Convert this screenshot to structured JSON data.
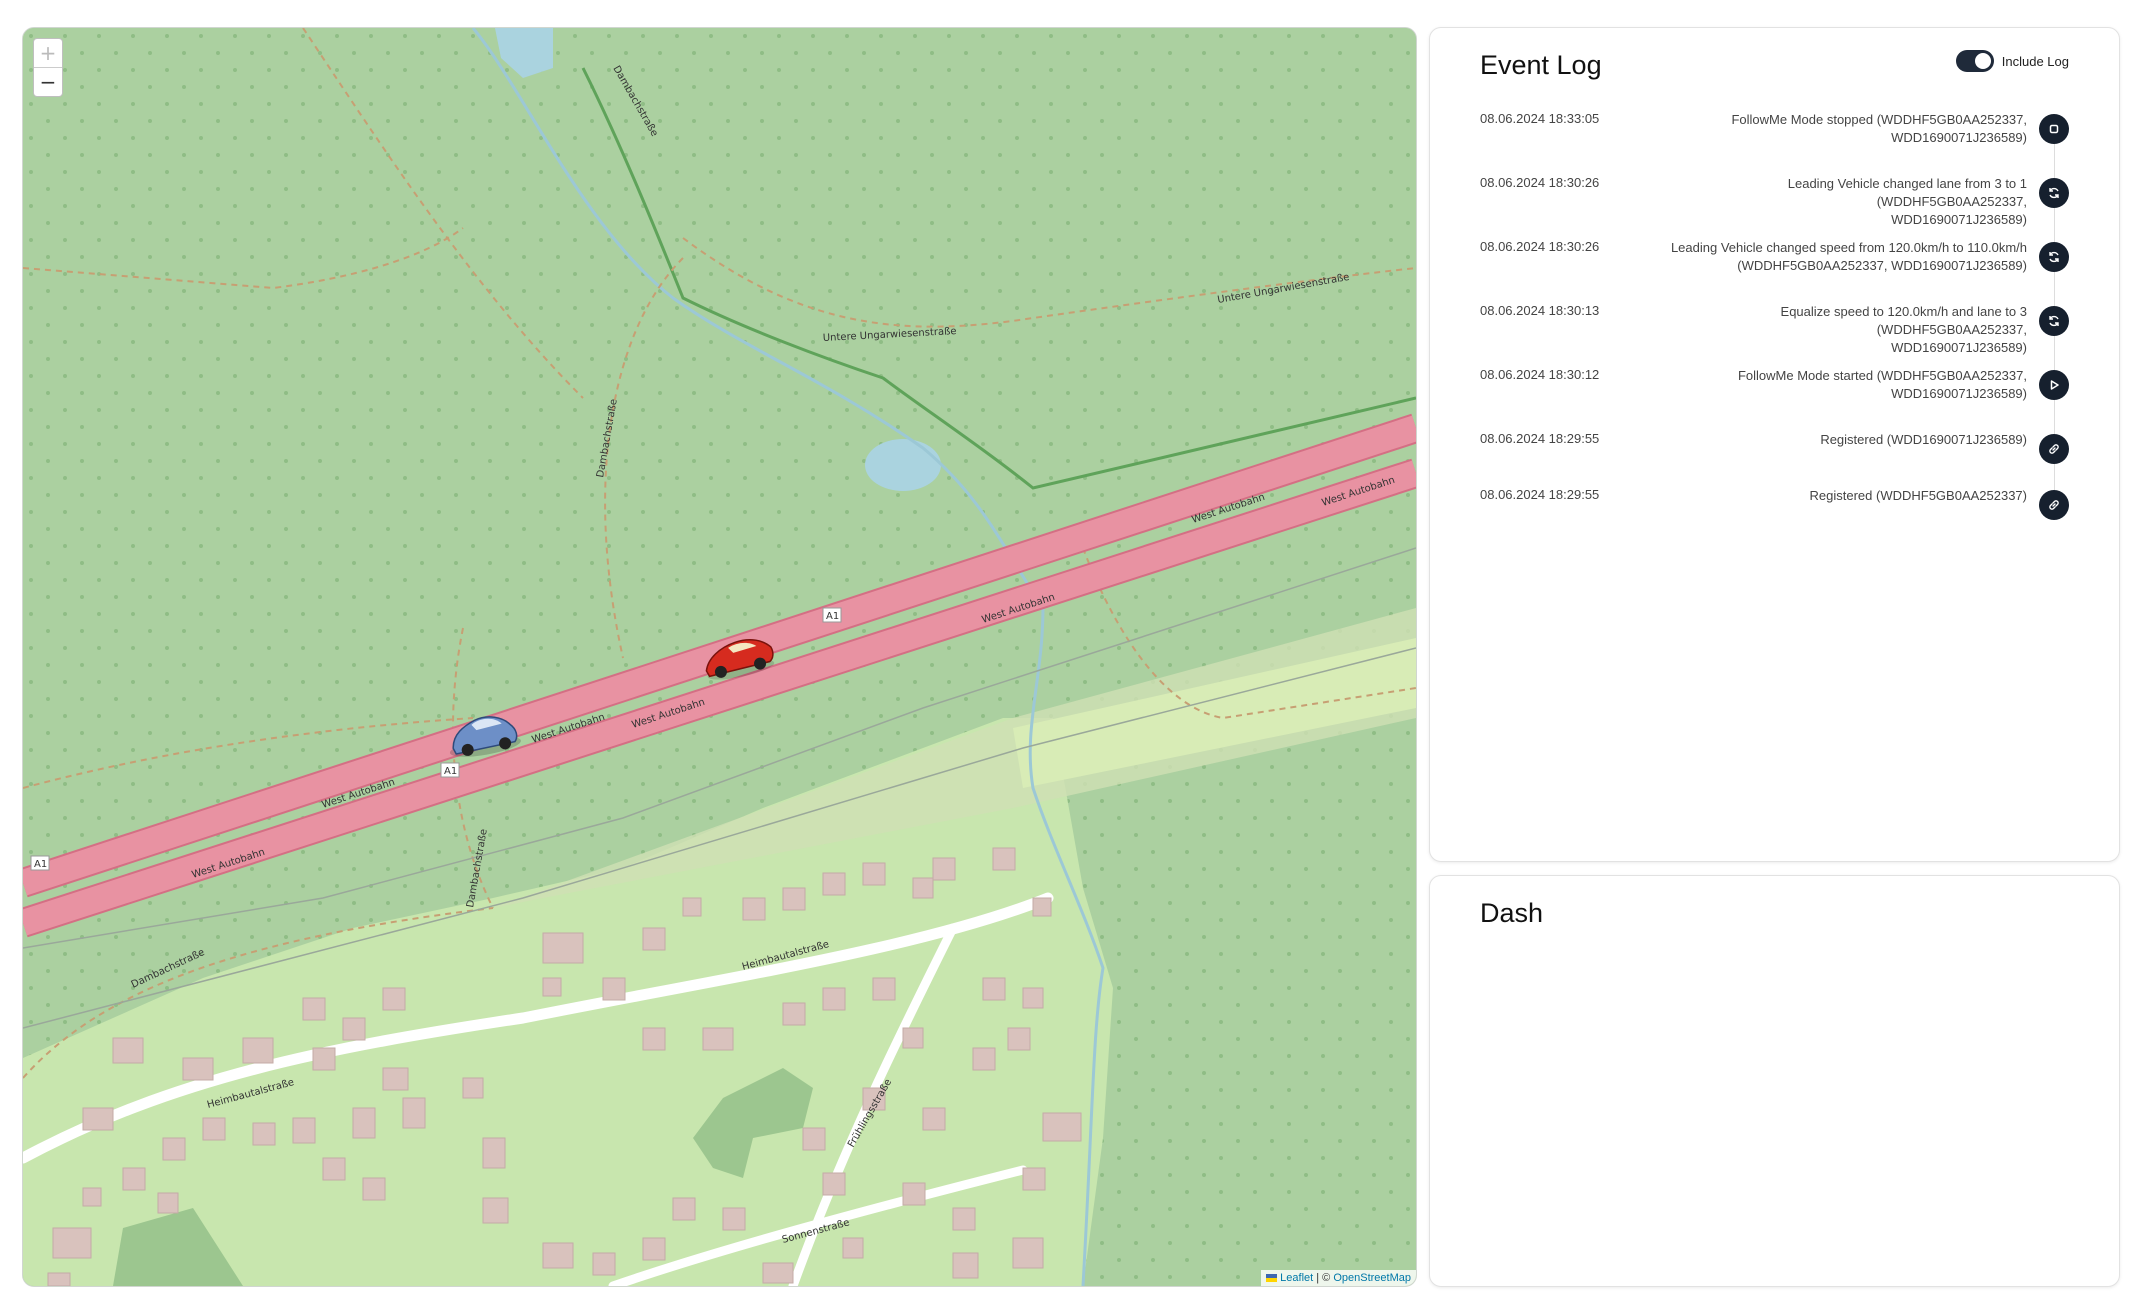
{
  "map": {
    "zoom_in": "+",
    "zoom_out": "−",
    "attribution_leaflet": "Leaflet",
    "attribution_sep": "| ©",
    "attribution_osm": "OpenStreetMap",
    "labels": {
      "west_autobahn": "West Autobahn",
      "a1": "A1",
      "heimbautal": "Heimbautalstraße",
      "untere_ungar": "Untere Ungarwiesenstraße",
      "dambach": "Dambachstraße",
      "sonnen": "Sonnenstraße",
      "fruehling": "Frühlingsstraße"
    }
  },
  "event_log": {
    "title": "Event Log",
    "include_log_label": "Include Log",
    "include_log_on": true,
    "events": [
      {
        "ts": "08.06.2024 18:33:05",
        "l1": "FollowMe Mode stopped (WDDHF5GB0AA252337,",
        "l2": "WDD1690071J236589)",
        "icon": "stop-icon"
      },
      {
        "ts": "08.06.2024 18:30:26",
        "l1": "Leading Vehicle changed lane from 3 to 1 (WDDHF5GB0AA252337,",
        "l2": "WDD1690071J236589)",
        "icon": "refresh-icon"
      },
      {
        "ts": "08.06.2024 18:30:26",
        "l1": "Leading Vehicle changed speed from 120.0km/h to 110.0km/h",
        "l2": "(WDDHF5GB0AA252337, WDD1690071J236589)",
        "icon": "refresh-icon"
      },
      {
        "ts": "08.06.2024 18:30:13",
        "l1": "Equalize speed to 120.0km/h and lane to 3 (WDDHF5GB0AA252337,",
        "l2": "WDD1690071J236589)",
        "icon": "refresh-icon"
      },
      {
        "ts": "08.06.2024 18:30:12",
        "l1": "FollowMe Mode started (WDDHF5GB0AA252337,",
        "l2": "WDD1690071J236589)",
        "icon": "play-icon"
      },
      {
        "ts": "08.06.2024 18:29:55",
        "l1": "Registered (WDD1690071J236589)",
        "l2": "",
        "icon": "link-icon"
      },
      {
        "ts": "08.06.2024 18:29:55",
        "l1": "Registered (WDDHF5GB0AA252337)",
        "l2": "",
        "icon": "link-icon"
      }
    ]
  },
  "dash": {
    "title": "Dash"
  },
  "colors": {
    "map_forest": "#abd0a0",
    "motorway": "#e892a2",
    "residential": "#c8e6ae",
    "building": "#d9c2bd",
    "accent_dark": "#16202e"
  }
}
